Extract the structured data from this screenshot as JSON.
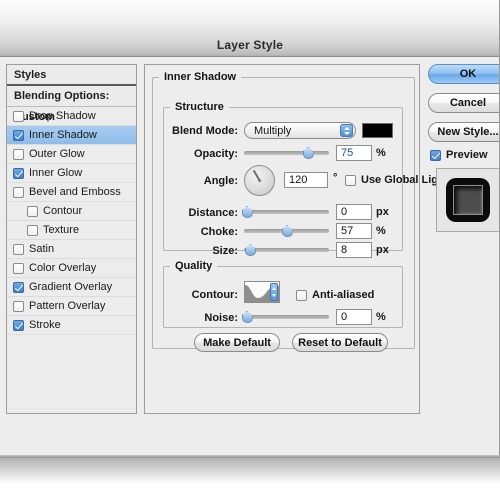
{
  "window": {
    "title": "Layer Style"
  },
  "styles_panel": {
    "header": "Styles",
    "blending_options": "Blending Options: Custom",
    "effects": [
      {
        "label": "Drop Shadow",
        "checked": false,
        "selected": false,
        "indent": false
      },
      {
        "label": "Inner Shadow",
        "checked": true,
        "selected": true,
        "indent": false
      },
      {
        "label": "Outer Glow",
        "checked": false,
        "selected": false,
        "indent": false
      },
      {
        "label": "Inner Glow",
        "checked": true,
        "selected": false,
        "indent": false
      },
      {
        "label": "Bevel and Emboss",
        "checked": false,
        "selected": false,
        "indent": false
      },
      {
        "label": "Contour",
        "checked": false,
        "selected": false,
        "indent": true
      },
      {
        "label": "Texture",
        "checked": false,
        "selected": false,
        "indent": true
      },
      {
        "label": "Satin",
        "checked": false,
        "selected": false,
        "indent": false
      },
      {
        "label": "Color Overlay",
        "checked": false,
        "selected": false,
        "indent": false
      },
      {
        "label": "Gradient Overlay",
        "checked": true,
        "selected": false,
        "indent": false
      },
      {
        "label": "Pattern Overlay",
        "checked": false,
        "selected": false,
        "indent": false
      },
      {
        "label": "Stroke",
        "checked": true,
        "selected": false,
        "indent": false
      }
    ]
  },
  "settings": {
    "group_title": "Inner Shadow",
    "structure": {
      "title": "Structure",
      "blend_mode_label": "Blend Mode:",
      "blend_mode_value": "Multiply",
      "shadow_color": "#000000",
      "opacity_label": "Opacity:",
      "opacity_value": "75",
      "opacity_unit": "%",
      "angle_label": "Angle:",
      "angle_value": "120",
      "angle_unit": "°",
      "use_global_light_label": "Use Global Light",
      "use_global_light_checked": false,
      "distance_label": "Distance:",
      "distance_value": "0",
      "distance_unit": "px",
      "choke_label": "Choke:",
      "choke_value": "57",
      "choke_unit": "%",
      "size_label": "Size:",
      "size_value": "8",
      "size_unit": "px"
    },
    "quality": {
      "title": "Quality",
      "contour_label": "Contour:",
      "anti_aliased_label": "Anti-aliased",
      "anti_aliased_checked": false,
      "noise_label": "Noise:",
      "noise_value": "0",
      "noise_unit": "%"
    },
    "make_default_label": "Make Default",
    "reset_to_default_label": "Reset to Default"
  },
  "actions": {
    "ok_label": "OK",
    "cancel_label": "Cancel",
    "new_style_label": "New Style...",
    "preview_label": "Preview",
    "preview_checked": true
  },
  "colors": {
    "selection_blue": "#8fbcea",
    "checkbox_blue": "#3d7fd1",
    "dialog_bg": "#ededed"
  }
}
